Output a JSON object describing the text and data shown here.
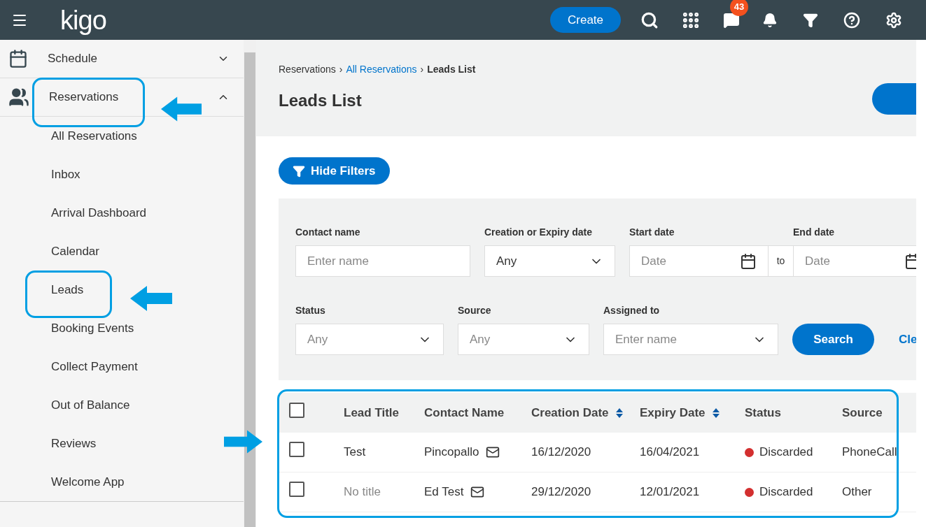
{
  "topbar": {
    "logo": "kigo",
    "create": "Create",
    "notifications_badge": "43"
  },
  "sidebar": {
    "items": [
      {
        "label": "Schedule",
        "expanded": false
      },
      {
        "label": "Reservations",
        "expanded": true,
        "children": [
          {
            "label": "All Reservations"
          },
          {
            "label": "Inbox"
          },
          {
            "label": "Arrival Dashboard"
          },
          {
            "label": "Calendar"
          },
          {
            "label": "Leads"
          },
          {
            "label": "Booking Events"
          },
          {
            "label": "Collect Payment"
          },
          {
            "label": "Out of Balance"
          },
          {
            "label": "Reviews"
          },
          {
            "label": "Welcome App"
          }
        ]
      }
    ]
  },
  "breadcrumb_separator": "›",
  "breadcrumb": [
    {
      "label": "Reservations",
      "link": false
    },
    {
      "label": "All Reservations",
      "link": true
    },
    {
      "label": "Leads List",
      "link": false
    }
  ],
  "page_title": "Leads List",
  "hide_filters": "Hide Filters",
  "filters": {
    "row_1": [
      {
        "label": "Contact name",
        "kind": "text",
        "placeholder": "Enter name"
      },
      {
        "label": "Creation or Expiry date",
        "kind": "select",
        "value": "Any"
      },
      {
        "label": "Start date",
        "kind": "date",
        "placeholder": "Date"
      },
      {
        "label": "End date",
        "kind": "date",
        "placeholder": "Date",
        "joiner": "to"
      }
    ],
    "row_2": [
      {
        "label": "Status",
        "kind": "select",
        "placeholder": "Any"
      },
      {
        "label": "Source",
        "kind": "select",
        "placeholder": "Any"
      },
      {
        "label": "Assigned to",
        "kind": "select",
        "placeholder": "Enter name"
      }
    ],
    "search": "Search",
    "clear": "Cle"
  },
  "table": {
    "columns": [
      {
        "label": "Lead Title",
        "sortable": false
      },
      {
        "label": "Contact Name",
        "sortable": false
      },
      {
        "label": "Creation Date",
        "sortable": true
      },
      {
        "label": "Expiry Date",
        "sortable": true
      },
      {
        "label": "Status",
        "sortable": false
      },
      {
        "label": "Source",
        "sortable": false
      }
    ],
    "header_checked": false,
    "rows": [
      {
        "checked": false,
        "title": "Test",
        "title_muted": false,
        "contact": "Pincopallo",
        "created": "16/12/2020",
        "expires": "16/04/2021",
        "status": "Discarded",
        "color": "#d32f2f",
        "source": "PhoneCall"
      },
      {
        "checked": false,
        "title": "No title",
        "title_muted": true,
        "contact": "Ed Test",
        "created": "29/12/2020",
        "expires": "12/01/2021",
        "status": "Discarded",
        "color": "#d32f2f",
        "source": "Other"
      }
    ]
  }
}
